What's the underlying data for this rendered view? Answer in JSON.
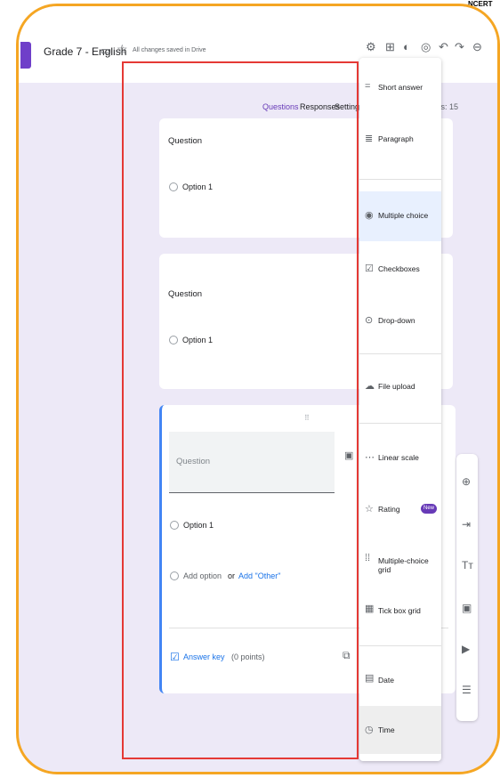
{
  "header": {
    "title": "Grade 7 - English",
    "saved_status": "All changes saved in Drive"
  },
  "tabs": [
    "Questions",
    "Responses",
    "Settings"
  ],
  "points_partial": "ts: 15",
  "cards": [
    {
      "question": "Question",
      "option": "Option 1"
    },
    {
      "question": "Question",
      "option": "Option 1"
    }
  ],
  "active_card": {
    "question_placeholder": "Question",
    "option": "Option 1",
    "add_option": "Add option",
    "or": "or",
    "add_other": "Add \"Other\"",
    "answer_key": "Answer key",
    "points": "(0 points)"
  },
  "menu": [
    {
      "label": "Short answer",
      "icon": "short-answer-icon"
    },
    {
      "label": "Paragraph",
      "icon": "paragraph-icon"
    },
    {
      "label": "Multiple choice",
      "icon": "radio-icon",
      "selected": true
    },
    {
      "label": "Checkboxes",
      "icon": "checkbox-icon"
    },
    {
      "label": "Drop-down",
      "icon": "dropdown-icon"
    },
    {
      "label": "File upload",
      "icon": "cloud-upload-icon"
    },
    {
      "label": "Linear scale",
      "icon": "linear-scale-icon"
    },
    {
      "label": "Rating",
      "icon": "star-icon",
      "badge": "New"
    },
    {
      "label": "Multiple-choice grid",
      "icon": "grid-dots-icon"
    },
    {
      "label": "Tick box grid",
      "icon": "grid-check-icon"
    },
    {
      "label": "Date",
      "icon": "calendar-icon"
    },
    {
      "label": "Time",
      "icon": "clock-icon",
      "hover": true
    }
  ],
  "watermark": "NCERT"
}
